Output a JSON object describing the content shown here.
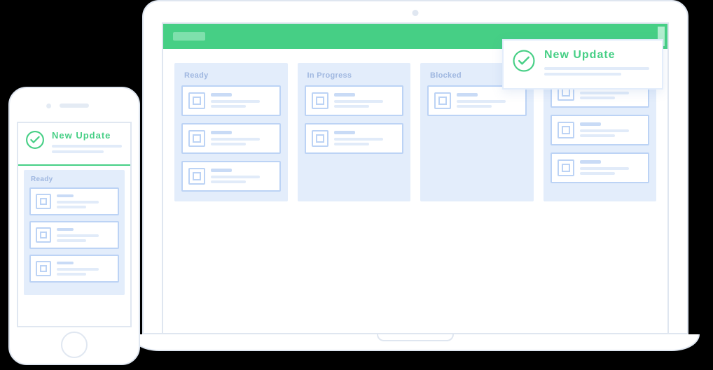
{
  "notification": {
    "title": "New Update"
  },
  "desktop": {
    "columns": [
      {
        "title": "Ready",
        "card_count": 3
      },
      {
        "title": "In Progress",
        "card_count": 2
      },
      {
        "title": "Blocked",
        "card_count": 1
      },
      {
        "title": "",
        "card_count": 3
      }
    ]
  },
  "mobile": {
    "column": {
      "title": "Ready",
      "card_count": 3
    }
  },
  "colors": {
    "accent_green": "#46cf85",
    "panel_blue": "#e3edfb",
    "line_blue": "#bcd3f5"
  }
}
